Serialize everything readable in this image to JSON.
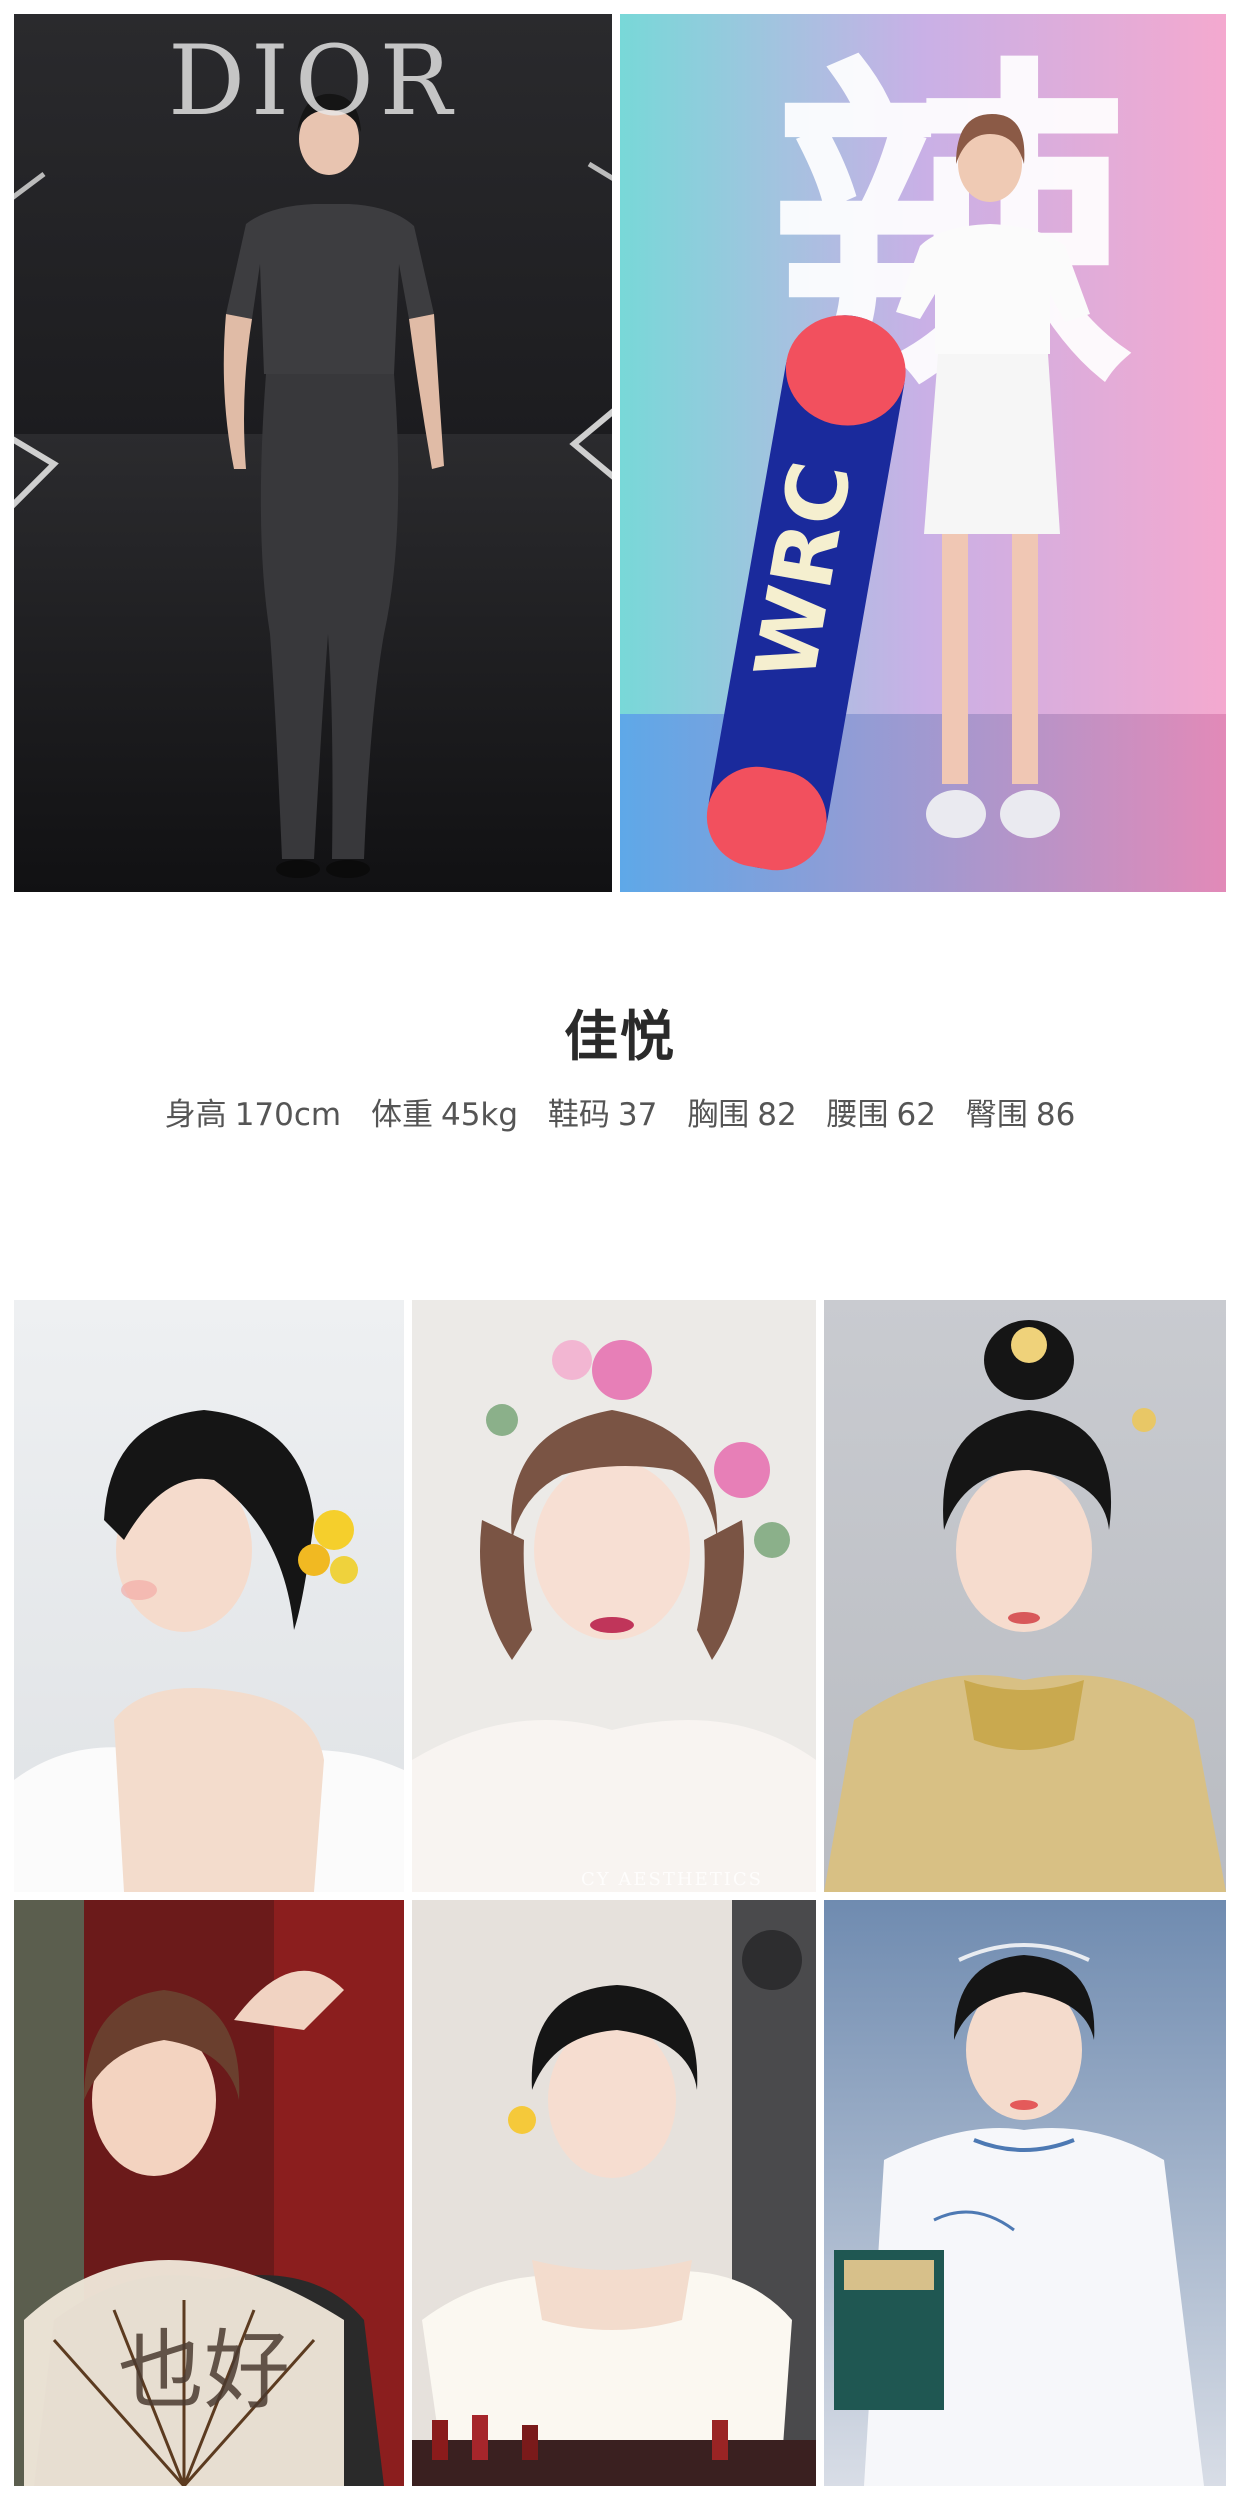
{
  "top_photos": [
    {
      "caption": "runway-dior",
      "brand_text": "DIOR"
    },
    {
      "caption": "snowboard-promo",
      "backdrop_text": "辣",
      "board_text": "WRC"
    }
  ],
  "profile": {
    "name": "佳悦",
    "stats": [
      {
        "label": "身高",
        "value": "170cm"
      },
      {
        "label": "体重",
        "value": "45kg"
      },
      {
        "label": "鞋码",
        "value": "37"
      },
      {
        "label": "胸围",
        "value": "82"
      },
      {
        "label": "腰围",
        "value": "62"
      },
      {
        "label": "臀围",
        "value": "86"
      }
    ]
  },
  "grid_photos": [
    {
      "caption": "bridal-yellow-flowers"
    },
    {
      "caption": "floral-crown-portrait",
      "watermark": "CY AESTHETICS"
    },
    {
      "caption": "traditional-gold-dress"
    },
    {
      "caption": "fan-portrait",
      "fan_text": "也好"
    },
    {
      "caption": "white-gown-portrait"
    },
    {
      "caption": "qipao-book-portrait"
    }
  ]
}
